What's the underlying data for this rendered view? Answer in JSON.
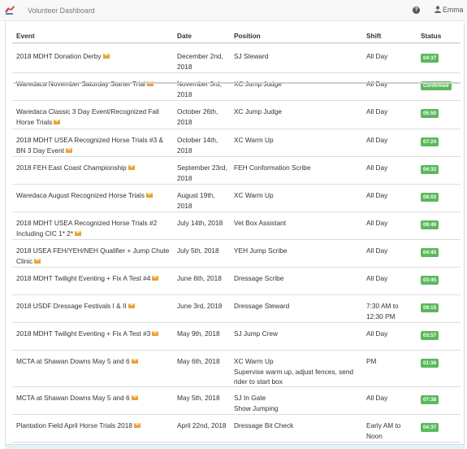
{
  "header": {
    "brand": "Volunteer Dashboard",
    "user": "Emma",
    "help_icon": "question-circle-icon",
    "user_icon": "user-icon"
  },
  "table": {
    "columns": [
      "Event",
      "Date",
      "Position",
      "Shift",
      "Status"
    ],
    "rows": [
      {
        "event": "2018 MDHT Donation Derby",
        "date": "December 2nd, 2018",
        "position": "SJ Steward",
        "shift": "All Day",
        "status": "04:37"
      },
      {
        "event": "Waredaca November Saturday Starter Trial",
        "date": "November 3rd, 2018",
        "position": "XC Jump Judge",
        "shift": "All Day",
        "status": "Confirmed"
      },
      {
        "event": "Waredaca Classic 3 Day Event/Recognized Fall Horse Trials",
        "date": "October 26th, 2018",
        "position": "XC Jump Judge",
        "shift": "All Day",
        "status": "05:50"
      },
      {
        "event": "2018 MDHT USEA Recognized Horse Trials #3 & BN 3 Day Event",
        "date": "October 14th, 2018",
        "position": "XC Warm Up",
        "shift": "All Day",
        "status": "07:24"
      },
      {
        "event": "2018 FEH East Coast Championship",
        "date": "September 23rd, 2018",
        "position": "FEH Conformation Scribe",
        "shift": "All Day",
        "status": "04:32"
      },
      {
        "event": "Waredaca August Recognized Horse Trials",
        "date": "August 19th, 2018",
        "position": "XC Warm Up",
        "shift": "All Day",
        "status": "08:02"
      },
      {
        "event": "2018 MDHT USEA Recognized Horse Trials #2 Including CIC 1* 2*",
        "date": "July 14th, 2018",
        "position": "Vet Box Assistant",
        "shift": "All Day",
        "status": "09:49"
      },
      {
        "event": "2018 USEA FEH/YEH/NEH Qualifier + Jump Chute Clinic",
        "date": "July 5th, 2018",
        "position": "YEH Jump Scribe",
        "shift": "All Day",
        "status": "04:45"
      },
      {
        "event": "2018 MDHT Twilight Eventing + Fix A Test #4",
        "date": "June 6th, 2018",
        "position": "Dressage Scribe",
        "shift": "All Day",
        "status": "03:45"
      },
      {
        "event": "2018 USDF Dressage Festivals I & II",
        "date": "June 3rd, 2018",
        "position": "Dressage Steward",
        "shift": "7:30 AM to 12:30 PM",
        "status": "09:15"
      },
      {
        "event": "2018 MDHT Twilight Eventing + Fix A Test #3",
        "date": "May 9th, 2018",
        "position": "SJ Jump Crew",
        "shift": "All Day",
        "status": "03:57"
      },
      {
        "event": "MCTA at Shawan Downs May 5 and 6",
        "date": "May 6th, 2018",
        "position": "XC Warm Up",
        "position_note": "Supervise warm up, adjust fences, send rider to start box",
        "shift": "PM",
        "status": "01:36"
      },
      {
        "event": "MCTA at Shawan Downs May 5 and 6",
        "date": "May 5th, 2018",
        "position": "SJ In Gate",
        "position_note": "Show Jumping",
        "shift": "All Day",
        "status": "07:38"
      },
      {
        "event": "Plantation Field April Horse Trials 2018",
        "date": "April 22nd, 2018",
        "position": "Dressage Bit Check",
        "shift": "Early AM to Noon",
        "status": "04:37"
      }
    ]
  }
}
